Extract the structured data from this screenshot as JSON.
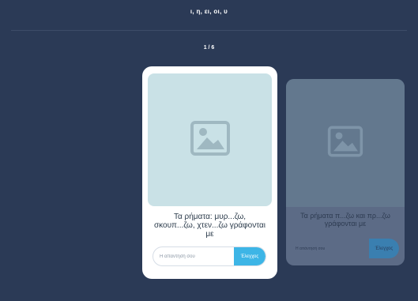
{
  "header": {
    "title": "ι, η, ει, οι, υ",
    "counter": "1 / 6"
  },
  "current_card": {
    "image_icon": "image-placeholder-icon",
    "question": "Τα ρήματα: μυρ...ζω, σκουπ...ζω, χτεν...ζω γράφονται με",
    "answer_placeholder": "Η απάντησή σου",
    "check_label": "Έλεγχος"
  },
  "next_card": {
    "image_icon": "image-placeholder-icon",
    "question": "Τα ρήματα π...ζω και πρ...ζω γράφονται με",
    "answer_placeholder": "Η απάντησή σου",
    "check_label": "Έλεγχος"
  },
  "colors": {
    "background": "#2b3a56",
    "accent": "#3db5e6",
    "image_bg": "#c9e1e6"
  }
}
